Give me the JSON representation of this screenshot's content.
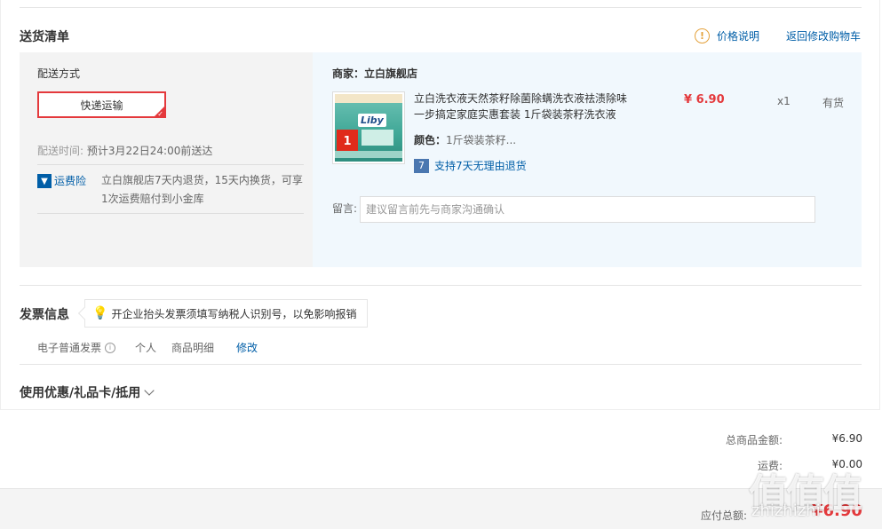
{
  "delivery": {
    "title": "送货清单",
    "price_note": "价格说明",
    "back_to_cart": "返回修改购物车",
    "shipping": {
      "label": "配送方式",
      "method": "快递运输",
      "time_label": "配送时间:",
      "time_value": "预计3月22日24:00前送达",
      "insurance_label": "运费险",
      "insurance_text": "立白旗舰店7天内退货，15天内换货，可享1次运费赔付到小金库"
    },
    "merchant": "商家：立白旗舰店",
    "product": {
      "name": "立白洗衣液天然茶籽除菌除螨洗衣液祛渍除味一步搞定家庭实惠套装 1斤袋装茶籽洗衣液",
      "color_label": "颜色：",
      "color_value": "1斤袋装茶籽...",
      "return_policy": "支持7天无理由退货",
      "price": "¥ 6.90",
      "qty": "x1",
      "stock": "有货",
      "image_logo": "Liby",
      "image_badge": "1"
    },
    "message": {
      "label": "留言:",
      "placeholder": "建议留言前先与商家沟通确认"
    }
  },
  "invoice": {
    "title": "发票信息",
    "tip": "开企业抬头发票须填写纳税人识别号，以免影响报销",
    "type": "电子普通发票",
    "holder": "个人",
    "content": "商品明细",
    "edit": "修改"
  },
  "coupon": {
    "title": "使用优惠/礼品卡/抵用"
  },
  "summary": {
    "goods_total_label": "总商品金额:",
    "goods_total_value": "¥6.90",
    "freight_label": "运费:",
    "freight_value": "¥0.00",
    "payable_label": "应付总额:",
    "payable_value": "¥6.90"
  },
  "watermark": {
    "glyphs": "值值值",
    "site": "zhizhizhi"
  },
  "colors": {
    "accent_red": "#e4393c",
    "link_blue": "#005ea7",
    "warning_orange": "#e4a23c"
  }
}
